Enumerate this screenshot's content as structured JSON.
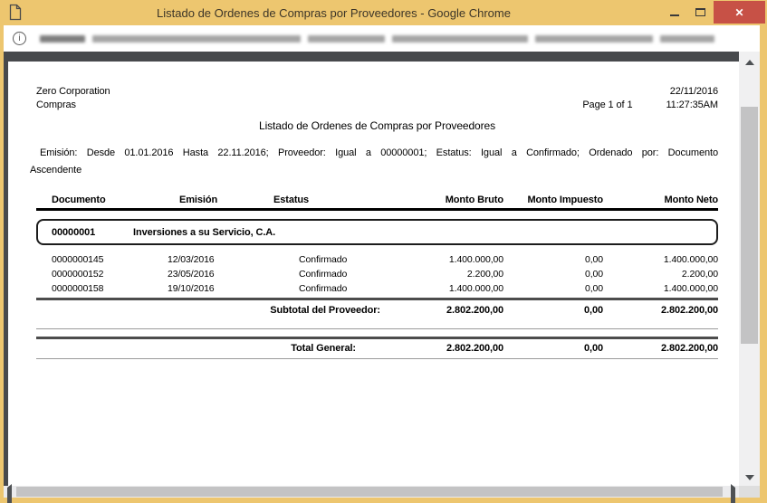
{
  "window": {
    "title": "Listado de Ordenes de Compras por Proveedores - Google Chrome",
    "close_glyph": "✕"
  },
  "urlbar": {
    "info_glyph": "i"
  },
  "report": {
    "company": "Zero Corporation",
    "module": "Compras",
    "date": "22/11/2016",
    "time": "11:27:35AM",
    "page_info": "Page 1 of 1",
    "title": "Listado de Ordenes de Compras por Proveedores",
    "filters": {
      "line1": "Emisión: Desde 01.01.2016 Hasta 22.11.2016; Proveedor: Igual a 00000001; Estatus: Igual a Confirmado; Ordenado por: Documento",
      "line2": "Ascendente"
    },
    "table": {
      "headers": [
        "Documento",
        "Emisión",
        "Estatus",
        "Monto Bruto",
        "Monto Impuesto",
        "Monto Neto"
      ],
      "group": {
        "code": "00000001",
        "name": "Inversiones a su Servicio, C.A."
      },
      "rows": [
        {
          "documento": "0000000145",
          "emision": "12/03/2016",
          "estatus": "Confirmado",
          "bruto": "1.400.000,00",
          "impuesto": "0,00",
          "neto": "1.400.000,00"
        },
        {
          "documento": "0000000152",
          "emision": "23/05/2016",
          "estatus": "Confirmado",
          "bruto": "2.200,00",
          "impuesto": "0,00",
          "neto": "2.200,00"
        },
        {
          "documento": "0000000158",
          "emision": "19/10/2016",
          "estatus": "Confirmado",
          "bruto": "1.400.000,00",
          "impuesto": "0,00",
          "neto": "1.400.000,00"
        }
      ],
      "subtotal": {
        "label": "Subtotal del Proveedor:",
        "bruto": "2.802.200,00",
        "impuesto": "0,00",
        "neto": "2.802.200,00"
      },
      "total": {
        "label": "Total General:",
        "bruto": "2.802.200,00",
        "impuesto": "0,00",
        "neto": "2.802.200,00"
      }
    }
  },
  "colors": {
    "titlebar": "#edc66f",
    "close_button": "#c75146",
    "frame_dark": "#47494c",
    "scroll_track": "#f0f0f1",
    "scroll_thumb": "#c3c3c4"
  }
}
